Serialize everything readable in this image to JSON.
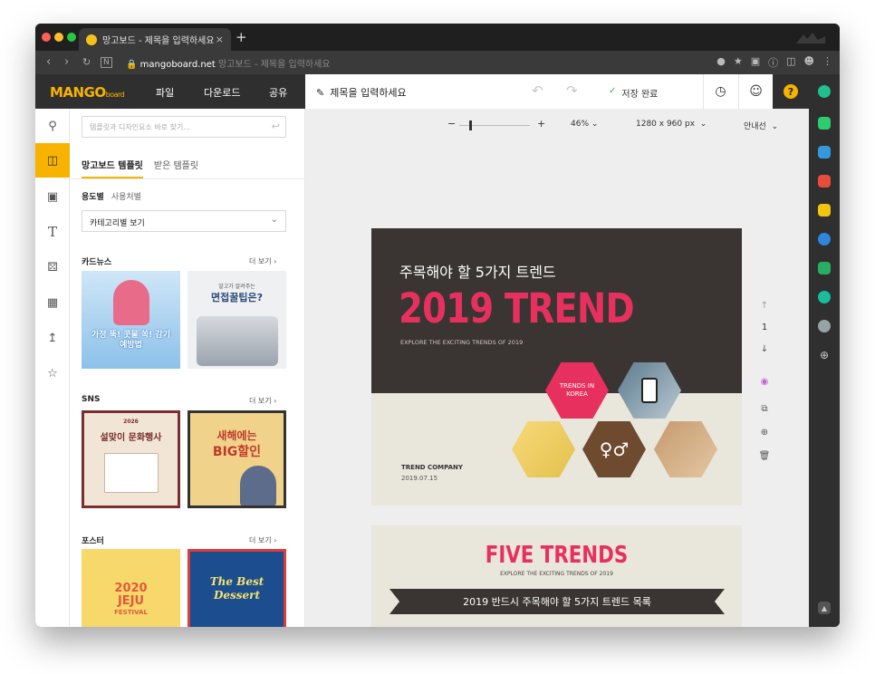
{
  "browser": {
    "tab_title": "망고보드 - 제목을 입력하세요",
    "tab_close": "×",
    "new_tab": "+",
    "url_domain": "mangoboard.net",
    "url_rest": "망고보드 - 제목을 입력하세요"
  },
  "header": {
    "logo": "MANGO",
    "logo_suffix": "board",
    "menu": [
      "파일",
      "다운로드",
      "공유"
    ],
    "doc_title": "제목을 입력하세요",
    "save_status": "저장 완료",
    "help": "?"
  },
  "search": {
    "placeholder": "템플릿과 디자인요소 바로 찾기..."
  },
  "panel": {
    "tabs": [
      "망고보드 템플릿",
      "받은 템플릿"
    ],
    "subtabs": [
      "용도별",
      "사용처별"
    ],
    "category_select": "카테고리별 보기",
    "more_label": "더 보기",
    "sections": [
      {
        "title": "카드뉴스"
      },
      {
        "title": "SNS"
      },
      {
        "title": "포스터"
      }
    ],
    "thumbs": {
      "t1": "가정 뚝! 콧물 쏙! 감기예방법",
      "t2a": "알고가 알려주는",
      "t2b": "면접꿀팁은?",
      "t3a": "2026",
      "t3b": "설맞이 문화행사",
      "t4a": "새해에는",
      "t4b": "BIG할인",
      "t5a": "2020",
      "t5b": "JEJU",
      "t5c": "FESTIVAL",
      "t6": "The Best Dessert"
    }
  },
  "canvas": {
    "zoom": "46%",
    "size": "1280 x 960 px",
    "guides": "안내선",
    "page_number": "1",
    "page1": {
      "kr_title": "주목해야 할 5가지 트렌드",
      "big_title": "2019 TREND",
      "subtitle": "EXPLORE THE EXCITING TRENDS OF 2019",
      "hex_label": "TRENDS IN KOREA",
      "company": "TREND COMPANY",
      "date": "2019.07.15"
    },
    "page2": {
      "title": "FIVE TRENDS",
      "subtitle": "EXPLORE THE EXCITING TRENDS OF 2019",
      "ribbon": "2019 반드시 주목해야 할 5가지 트렌드 목록"
    }
  },
  "colors": {
    "brand": "#f7b300",
    "accent_pink": "#e8305e",
    "dark_bg": "#3a3533",
    "save_check": "#2db36b"
  }
}
